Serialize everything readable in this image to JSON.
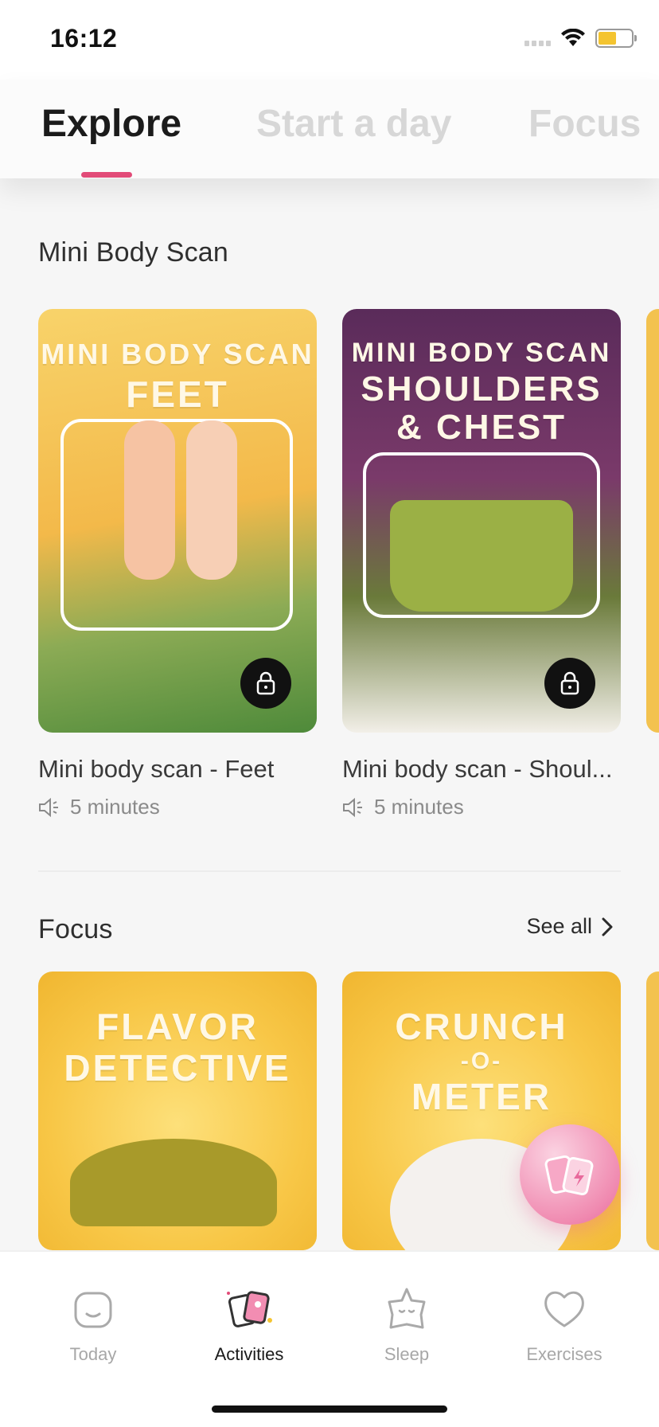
{
  "status_bar": {
    "time": "16:12"
  },
  "top_tabs": [
    {
      "label": "Explore",
      "active": true
    },
    {
      "label": "Start a day",
      "active": false
    },
    {
      "label": "Focus",
      "active": false
    }
  ],
  "sections": {
    "mini_body_scan": {
      "title": "Mini Body Scan",
      "cards": [
        {
          "art_line1": "MINI BODY SCAN",
          "art_line2": "FEET",
          "title": "Mini body scan - Feet",
          "duration": "5 minutes",
          "locked": true
        },
        {
          "art_line1": "MINI BODY SCAN",
          "art_line2": "SHOULDERS",
          "art_line3": "& CHEST",
          "title": "Mini body scan - Shoul...",
          "duration": "5 minutes",
          "locked": true
        }
      ]
    },
    "focus": {
      "title": "Focus",
      "see_all": "See all",
      "cards": [
        {
          "art_line1": "FLAVOR",
          "art_line2": "DETECTIVE"
        },
        {
          "art_line1": "CRUNCH",
          "art_line2": "-O-",
          "art_line3": "METER"
        }
      ]
    }
  },
  "bottom_nav": [
    {
      "label": "Today",
      "icon": "face-icon",
      "active": false
    },
    {
      "label": "Activities",
      "icon": "cards-icon",
      "active": true
    },
    {
      "label": "Sleep",
      "icon": "star-face-icon",
      "active": false
    },
    {
      "label": "Exercises",
      "icon": "heart-icon",
      "active": false
    }
  ],
  "colors": {
    "accent": "#e24b78",
    "fab": "#f08bb1"
  }
}
